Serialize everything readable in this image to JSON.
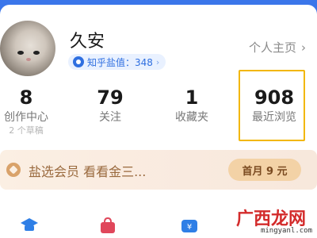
{
  "profile": {
    "username": "久安",
    "salt_badge": "知乎盐值：348",
    "homepage_link": "个人主页"
  },
  "stats": [
    {
      "value": "8",
      "label": "创作中心",
      "sub": "2 个草稿"
    },
    {
      "value": "79",
      "label": "关注",
      "sub": ""
    },
    {
      "value": "1",
      "label": "收藏夹",
      "sub": ""
    },
    {
      "value": "908",
      "label": "最近浏览",
      "sub": ""
    }
  ],
  "vip": {
    "text": "盐选会员  看看金三...",
    "button": "首月 9 元"
  },
  "bottom_icons": [
    "graduation-cap-icon",
    "shopping-bag-icon",
    "wallet-icon"
  ],
  "watermark": {
    "text": "广西龙网",
    "url": "mingyanl.com"
  },
  "colors": {
    "accent": "#3b76ea",
    "highlight_frame": "#f2b705",
    "vip_text": "#9a6a3e"
  }
}
